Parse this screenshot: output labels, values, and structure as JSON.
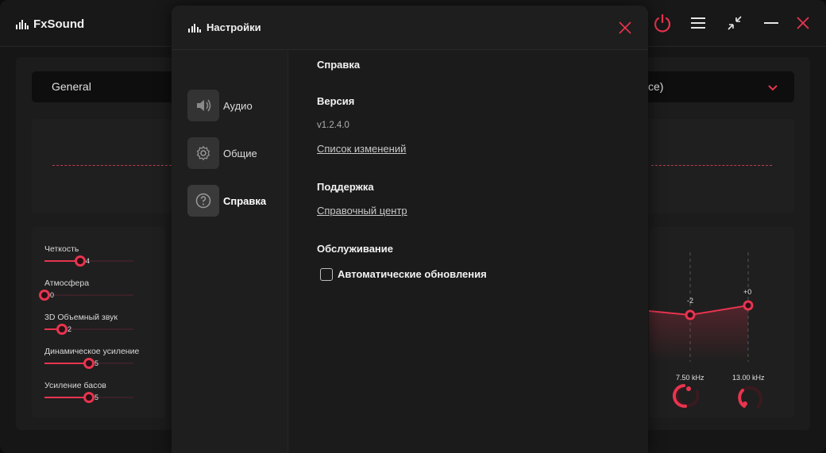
{
  "app": {
    "name": "FxSound"
  },
  "colors": {
    "accent": "#e8344f",
    "background": "#161616",
    "dialog": "#1b1b1b"
  },
  "titlebar": {
    "icons": [
      "power-icon",
      "menu-icon",
      "shrink-icon",
      "minimize-icon",
      "close-icon"
    ]
  },
  "preset": {
    "name": "General",
    "device_partial": "ce)"
  },
  "effects": [
    {
      "label": "Четкость",
      "value": "4",
      "level": 0.4
    },
    {
      "label": "Атмосфера",
      "value": "0",
      "level": 0.0
    },
    {
      "label": "3D Объемный звук",
      "value": "2",
      "level": 0.2
    },
    {
      "label": "Динамическое усиление",
      "value": "5",
      "level": 0.5
    },
    {
      "label": "Усиление басов",
      "value": "5",
      "level": 0.5
    }
  ],
  "eq": {
    "bands": [
      {
        "gain": "-2",
        "freq": "7.50 kHz"
      },
      {
        "gain": "+0",
        "freq": "13.00 kHz"
      }
    ]
  },
  "settings": {
    "title": "Настройки",
    "nav": [
      {
        "label": "Аудио",
        "icon": "speaker-icon"
      },
      {
        "label": "Общие",
        "icon": "gear-icon"
      },
      {
        "label": "Справка",
        "icon": "help-icon"
      }
    ],
    "help": {
      "heading": "Справка",
      "version_label": "Версия",
      "version_value": "v1.2.4.0",
      "changelog_link": "Список изменений",
      "support_label": "Поддержка",
      "help_center_link": "Справочный центр",
      "maintenance_label": "Обслуживание",
      "auto_updates_label": "Автоматические обновления",
      "auto_updates_checked": false
    }
  }
}
